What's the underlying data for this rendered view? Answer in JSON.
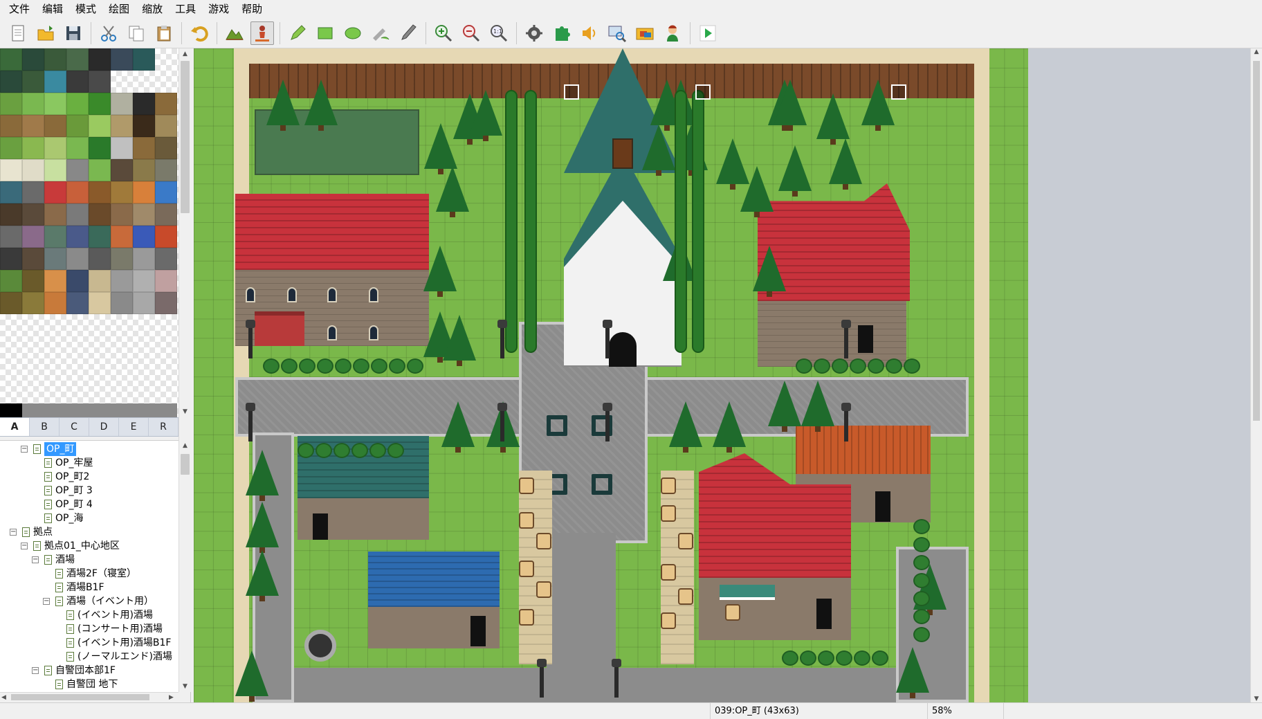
{
  "menu": [
    "文件",
    "编辑",
    "模式",
    "绘图",
    "缩放",
    "工具",
    "游戏",
    "帮助"
  ],
  "toolbar": [
    {
      "icon": "new-project-icon"
    },
    {
      "icon": "open-project-icon"
    },
    {
      "icon": "save-project-icon"
    },
    {
      "sep": true
    },
    {
      "icon": "cut-icon"
    },
    {
      "icon": "copy-icon"
    },
    {
      "icon": "paste-icon"
    },
    {
      "sep": true
    },
    {
      "icon": "undo-icon"
    },
    {
      "sep": true
    },
    {
      "icon": "map-mode-icon"
    },
    {
      "icon": "event-mode-icon",
      "active": true
    },
    {
      "sep": true
    },
    {
      "icon": "pencil-icon"
    },
    {
      "icon": "rectangle-icon"
    },
    {
      "icon": "ellipse-icon"
    },
    {
      "icon": "fill-icon"
    },
    {
      "icon": "shadow-pen-icon"
    },
    {
      "sep": true
    },
    {
      "icon": "zoom-in-icon"
    },
    {
      "icon": "zoom-out-icon"
    },
    {
      "icon": "zoom-actual-icon"
    },
    {
      "sep": true
    },
    {
      "icon": "database-icon"
    },
    {
      "icon": "plugin-manager-icon"
    },
    {
      "icon": "sound-test-icon"
    },
    {
      "icon": "event-search-icon"
    },
    {
      "icon": "resource-manager-icon"
    },
    {
      "icon": "character-generator-icon"
    },
    {
      "sep": true
    },
    {
      "icon": "playtest-icon"
    }
  ],
  "tileset_tabs": [
    "A",
    "B",
    "C",
    "D",
    "E",
    "R"
  ],
  "tileset_active": "A",
  "map_tree": [
    {
      "label": "OP_町",
      "depth": 1,
      "toggle": "⊟",
      "selected": true
    },
    {
      "label": "OP_牢屋",
      "depth": 2
    },
    {
      "label": "OP_町2",
      "depth": 2
    },
    {
      "label": "OP_町 3",
      "depth": 2
    },
    {
      "label": "OP_町 4",
      "depth": 2
    },
    {
      "label": "OP_海",
      "depth": 2
    },
    {
      "label": "拠点",
      "depth": 0,
      "toggle": "⊟"
    },
    {
      "label": "拠点01_中心地区",
      "depth": 1,
      "toggle": "⊟"
    },
    {
      "label": "酒場",
      "depth": 2,
      "toggle": "⊟"
    },
    {
      "label": "酒場2F（寝室）",
      "depth": 3
    },
    {
      "label": "酒場B1F",
      "depth": 3
    },
    {
      "label": " 酒場（イベント用）",
      "depth": 3,
      "toggle": "⊟"
    },
    {
      "label": "(イベント用)酒場",
      "depth": 4
    },
    {
      "label": "(コンサート用)酒場",
      "depth": 4
    },
    {
      "label": "(イベント用)酒場B1F",
      "depth": 4
    },
    {
      "label": "(ノーマルエンド)酒場",
      "depth": 4
    },
    {
      "label": "自警団本部1F",
      "depth": 2,
      "toggle": "⊟"
    },
    {
      "label": "自警団 地下",
      "depth": 3
    }
  ],
  "status": {
    "map_info": "039:OP_町 (43x63)",
    "zoom": "58%"
  },
  "colors": {
    "grass": "#7ab84a",
    "wall_wood": "#7a4a2a",
    "road": "#8c8c8c",
    "road_edge": "#c9c9c9",
    "roof_red": "#c8323c",
    "roof_teal": "#2f6f6a",
    "roof_blue": "#2d6bb0",
    "roof_orange": "#c85a2a",
    "stone_wall": "#8a7a6a",
    "border_sand": "#e6d8b4",
    "selection": "#3399ff"
  }
}
